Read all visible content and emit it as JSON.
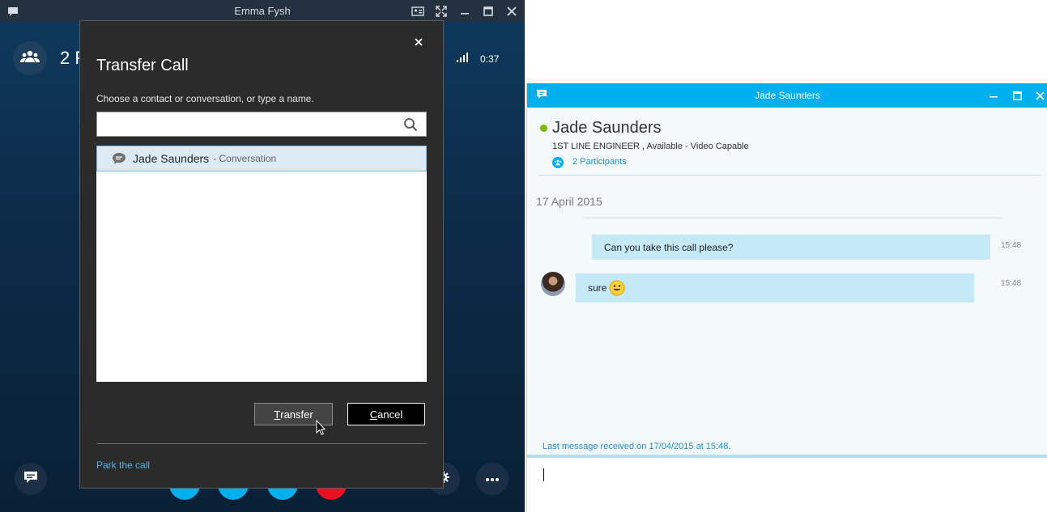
{
  "call_window": {
    "title": "Emma Fysh",
    "header_text": "2 P",
    "call_time": "0:37"
  },
  "transfer_dialog": {
    "title": "Transfer Call",
    "instruction": "Choose a contact or conversation, or type a name.",
    "search": {
      "value": "",
      "placeholder": ""
    },
    "results": [
      {
        "name": "Jade Saunders",
        "type": "- Conversation"
      }
    ],
    "transfer_label_accel": "T",
    "transfer_label_rest": "ransfer",
    "cancel_label_accel": "C",
    "cancel_label_rest": "ancel",
    "park_link": "Park the call"
  },
  "conversation_window": {
    "title": "Jade Saunders",
    "contact_name": "Jade Saunders",
    "contact_status": "1ST LINE ENGINEER ,  Available - Video Capable",
    "participants_link": "2 Participants",
    "date_label": "17 April 2015",
    "messages": [
      {
        "text": "Can you take this call please?",
        "time": "15:48"
      },
      {
        "text": "sure",
        "time": "15:48"
      }
    ],
    "last_message": "Last message received on 17/04/2015 at 15:48."
  },
  "colors": {
    "accent": "#00aff0",
    "presence_available": "#7fba00",
    "link": "#1f8fd1",
    "dialog_bg": "#2b2b2b",
    "bubble": "#c6e9f8"
  },
  "icons": {
    "app": "chat-bubble-icon",
    "participants": "people-icon",
    "signal": "signal-bars-icon",
    "search": "search-icon",
    "close": "close-icon",
    "emoji": "smiley-icon"
  }
}
